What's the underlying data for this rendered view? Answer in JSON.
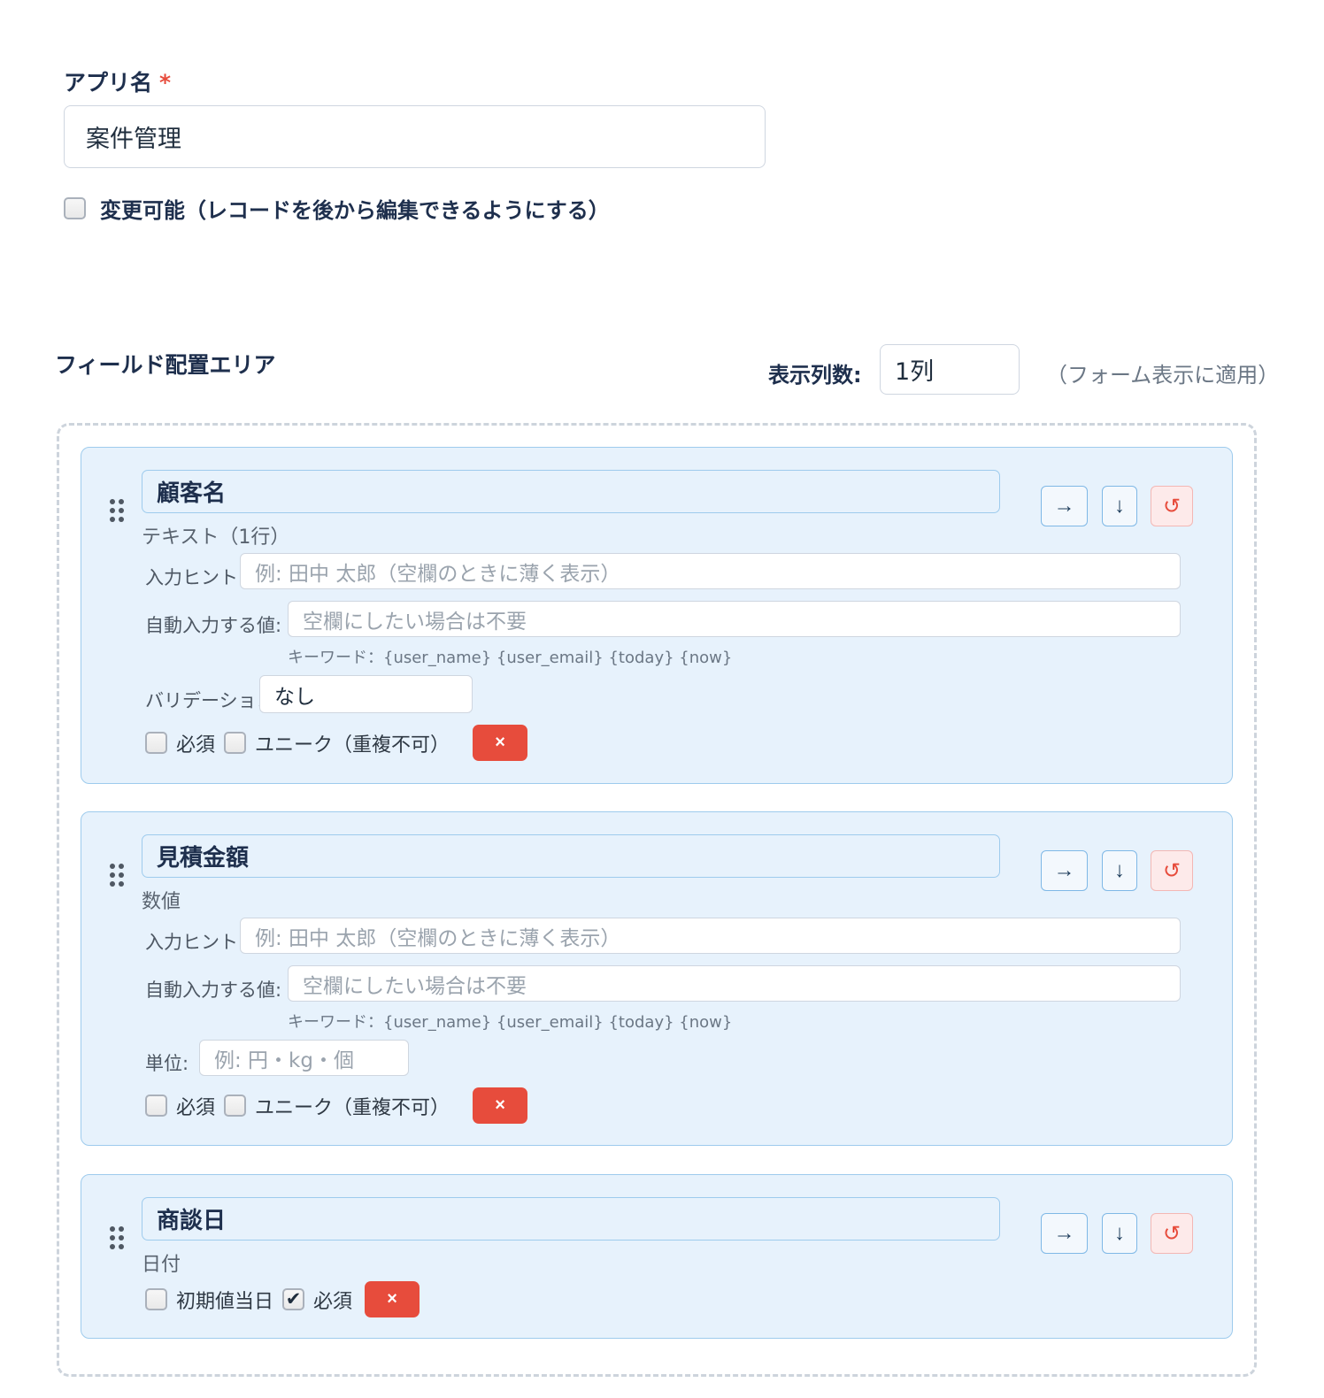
{
  "app": {
    "label": "アプリ名",
    "required_mark": "*",
    "name_value": "案件管理",
    "editable_label": "変更可能（レコードを後から編集できるようにする）",
    "editable_checked": false
  },
  "layout_area": {
    "title": "フィールド配置エリア",
    "columns_label": "表示列数:",
    "columns_value": "1列",
    "columns_note": "（フォーム表示に適用）"
  },
  "common": {
    "hint_label": "入力ヒント:",
    "default_label": "自動入力する値:",
    "keywords": "キーワード：{user_name} {user_email} {today} {now}",
    "required_label": "必須",
    "unique_label": "ユニーク（重複不可）",
    "delete_label": "×",
    "move_right_label": "→",
    "move_down_label": "↓",
    "reset_label": "↺"
  },
  "fields": [
    {
      "title": "顧客名",
      "type": "テキスト（1行）",
      "hint_placeholder": "例: 田中 太郎（空欄のときに薄く表示）",
      "default_placeholder": "空欄にしたい場合は不要",
      "validation_label": "バリデーション:",
      "validation_value": "なし",
      "required": false,
      "unique": false
    },
    {
      "title": "見積金額",
      "type": "数値",
      "hint_placeholder": "例: 田中 太郎（空欄のときに薄く表示）",
      "default_placeholder": "空欄にしたい場合は不要",
      "unit_label": "単位:",
      "unit_placeholder": "例: 円・kg・個",
      "required": false,
      "unique": false
    },
    {
      "title": "商談日",
      "type": "日付",
      "today_default_label": "初期値当日",
      "today_default": false,
      "required": true
    }
  ]
}
